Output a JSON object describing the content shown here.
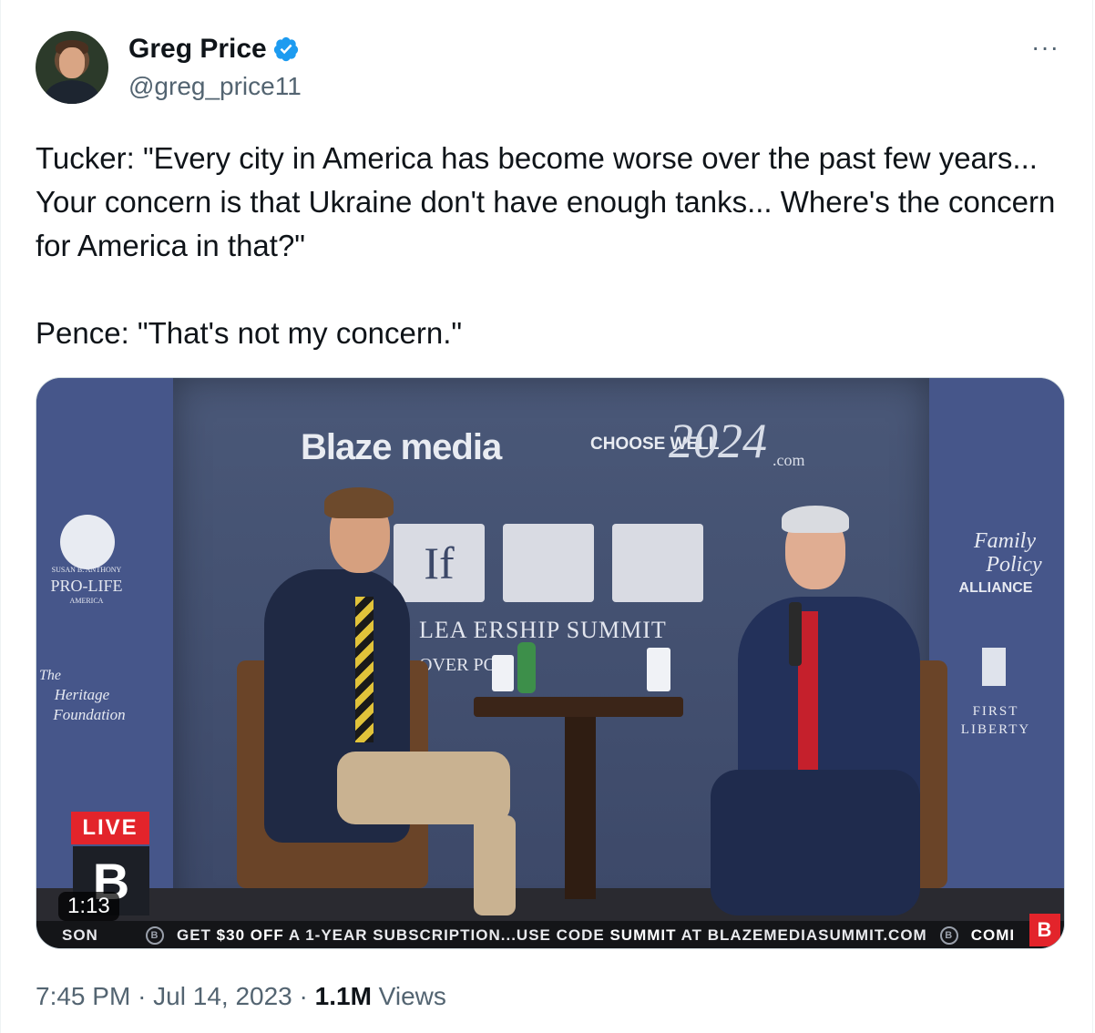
{
  "author": {
    "name": "Greg Price",
    "handle": "@greg_price11",
    "verified": true,
    "accent_color": "#1d9bf0"
  },
  "menu": {
    "more_label": "···"
  },
  "tweet": {
    "paragraph1": "Tucker: \"Every city in America has become worse over the past few years... Your concern is that Ukraine don't have enough tanks... Where's the concern for America in that?\"",
    "paragraph2": "Pence: \"That's not my concern.\""
  },
  "video": {
    "duration": "1:13",
    "live_label": "LIVE",
    "backdrop": {
      "brand": "Blaze media",
      "choose": "CHOOSE WELL",
      "year": "2024",
      "domain": ".com",
      "summit_title": "LEA ERSHIP SUMMIT",
      "summit_sub": "OVER POLI S",
      "logo_letters": "If"
    },
    "sponsors": {
      "left_top": "PRO-LIFE",
      "left_top_small": "SUSAN B. ANTHONY",
      "left_top_small2": "AMERICA",
      "left_bottom_1": "The",
      "left_bottom_2": "Heritage",
      "left_bottom_3": "Foundation",
      "right_top_1": "Family",
      "right_top_2": "Policy",
      "right_top_3": "ALLIANCE",
      "right_bottom_1": "FIRST",
      "right_bottom_2": "LIBERTY"
    },
    "ticker": {
      "left": "SON",
      "promo_prefix": "GET ",
      "promo_amount": "$30 OFF",
      "promo_mid": " A 1-YEAR SUBSCRIPTION...USE CODE ",
      "promo_code": "SUMMIT",
      "promo_suffix": " AT BLAZEMEDIASUMMIT.COM",
      "right": "COMI",
      "circle_icon": "B"
    }
  },
  "meta": {
    "time": "7:45 PM",
    "date": "Jul 14, 2023",
    "views_count": "1.1M",
    "views_label": "Views",
    "separator": "·"
  }
}
